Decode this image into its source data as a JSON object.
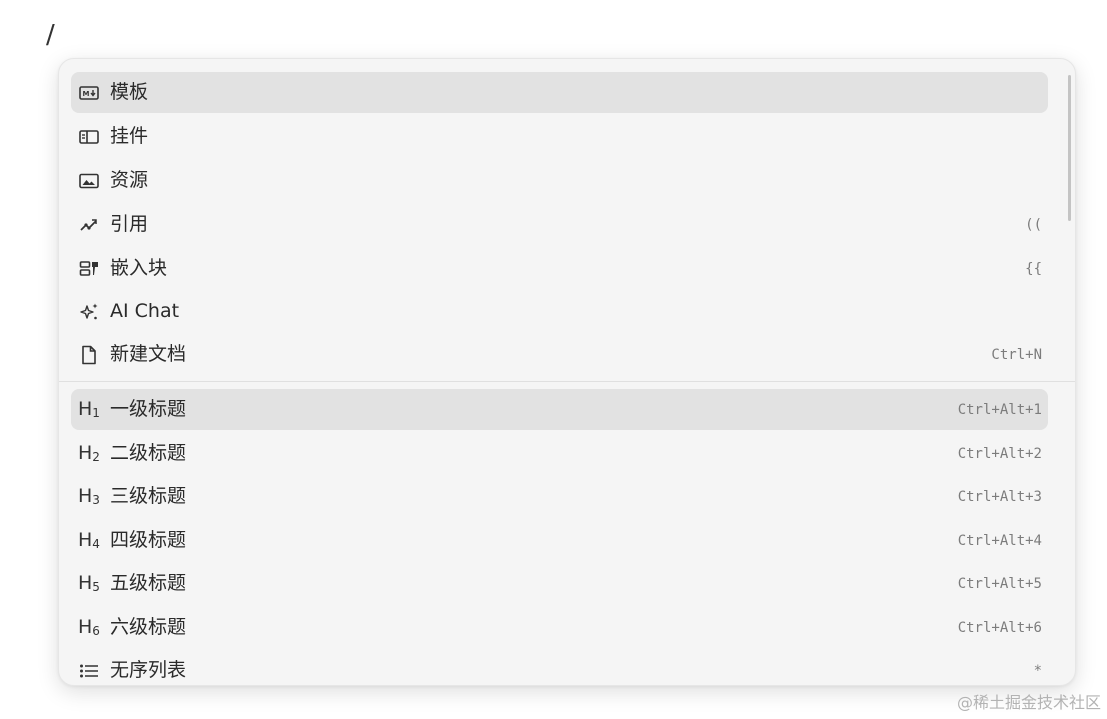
{
  "editor": {
    "trigger_text": "/"
  },
  "menu": {
    "groups": [
      {
        "items": [
          {
            "label": "模板",
            "icon": "markdown-template-icon",
            "shortcut": ""
          },
          {
            "label": "挂件",
            "icon": "widget-icon",
            "shortcut": ""
          },
          {
            "label": "资源",
            "icon": "image-asset-icon",
            "shortcut": ""
          },
          {
            "label": "引用",
            "icon": "reference-link-icon",
            "shortcut": "(("
          },
          {
            "label": "嵌入块",
            "icon": "embed-block-icon",
            "shortcut": "{{"
          },
          {
            "label": "AI Chat",
            "icon": "sparkle-ai-icon",
            "shortcut": ""
          },
          {
            "label": "新建文档",
            "icon": "new-document-icon",
            "shortcut": "Ctrl+N"
          }
        ]
      },
      {
        "items": [
          {
            "label": "一级标题",
            "icon_text": "H",
            "icon_sub": "1",
            "shortcut": "Ctrl+Alt+1"
          },
          {
            "label": "二级标题",
            "icon_text": "H",
            "icon_sub": "2",
            "shortcut": "Ctrl+Alt+2"
          },
          {
            "label": "三级标题",
            "icon_text": "H",
            "icon_sub": "3",
            "shortcut": "Ctrl+Alt+3"
          },
          {
            "label": "四级标题",
            "icon_text": "H",
            "icon_sub": "4",
            "shortcut": "Ctrl+Alt+4"
          },
          {
            "label": "五级标题",
            "icon_text": "H",
            "icon_sub": "5",
            "shortcut": "Ctrl+Alt+5"
          },
          {
            "label": "六级标题",
            "icon_text": "H",
            "icon_sub": "6",
            "shortcut": "Ctrl+Alt+6"
          },
          {
            "label": "无序列表",
            "icon": "bullet-list-icon",
            "shortcut": "*"
          }
        ]
      }
    ]
  },
  "watermark": "@稀土掘金技术社区",
  "colors": {
    "menu_background": "#f5f5f5",
    "active_item": "#e2e2e2",
    "shortcut_text": "#7c7c7c"
  }
}
